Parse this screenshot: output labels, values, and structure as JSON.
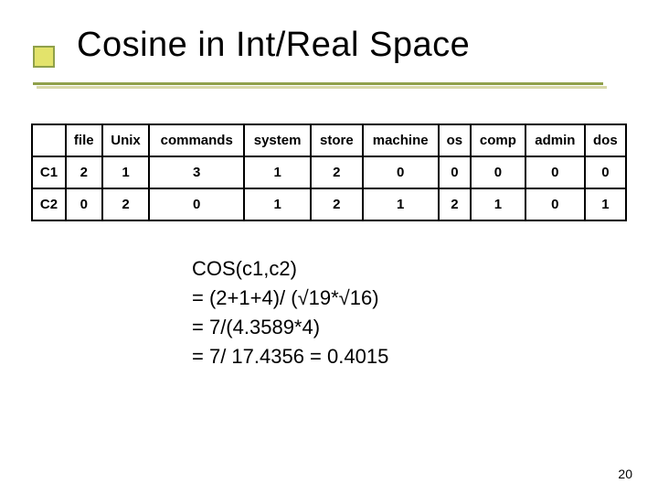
{
  "title": "Cosine in Int/Real Space",
  "table": {
    "corner": "",
    "headers": [
      "file",
      "Unix",
      "commands",
      "system",
      "store",
      "machine",
      "os",
      "comp",
      "admin",
      "dos"
    ],
    "rows": [
      {
        "label": "C1",
        "values": [
          "2",
          "1",
          "3",
          "1",
          "2",
          "0",
          "0",
          "0",
          "0",
          "0"
        ]
      },
      {
        "label": "C2",
        "values": [
          "0",
          "2",
          "0",
          "1",
          "2",
          "1",
          "2",
          "1",
          "0",
          "1"
        ]
      }
    ]
  },
  "calc": {
    "l0": "COS(c1,c2)",
    "l1": "= (2+1+4)/ (√19*√16)",
    "l2": "= 7/(4.3589*4)",
    "l3": "= 7/ 17.4356 = 0.4015"
  },
  "page": "20",
  "chart_data": {
    "type": "table",
    "columns": [
      "file",
      "Unix",
      "commands",
      "system",
      "store",
      "machine",
      "os",
      "comp",
      "admin",
      "dos"
    ],
    "rows": [
      {
        "label": "C1",
        "values": [
          2,
          1,
          3,
          1,
          2,
          0,
          0,
          0,
          0,
          0
        ]
      },
      {
        "label": "C2",
        "values": [
          0,
          2,
          0,
          1,
          2,
          1,
          2,
          1,
          0,
          1
        ]
      }
    ],
    "derived": {
      "dot_product": 7,
      "norm_c1": 4.3589,
      "norm_c2": 4,
      "product_of_norms": 17.4356,
      "cosine": 0.4015
    }
  }
}
